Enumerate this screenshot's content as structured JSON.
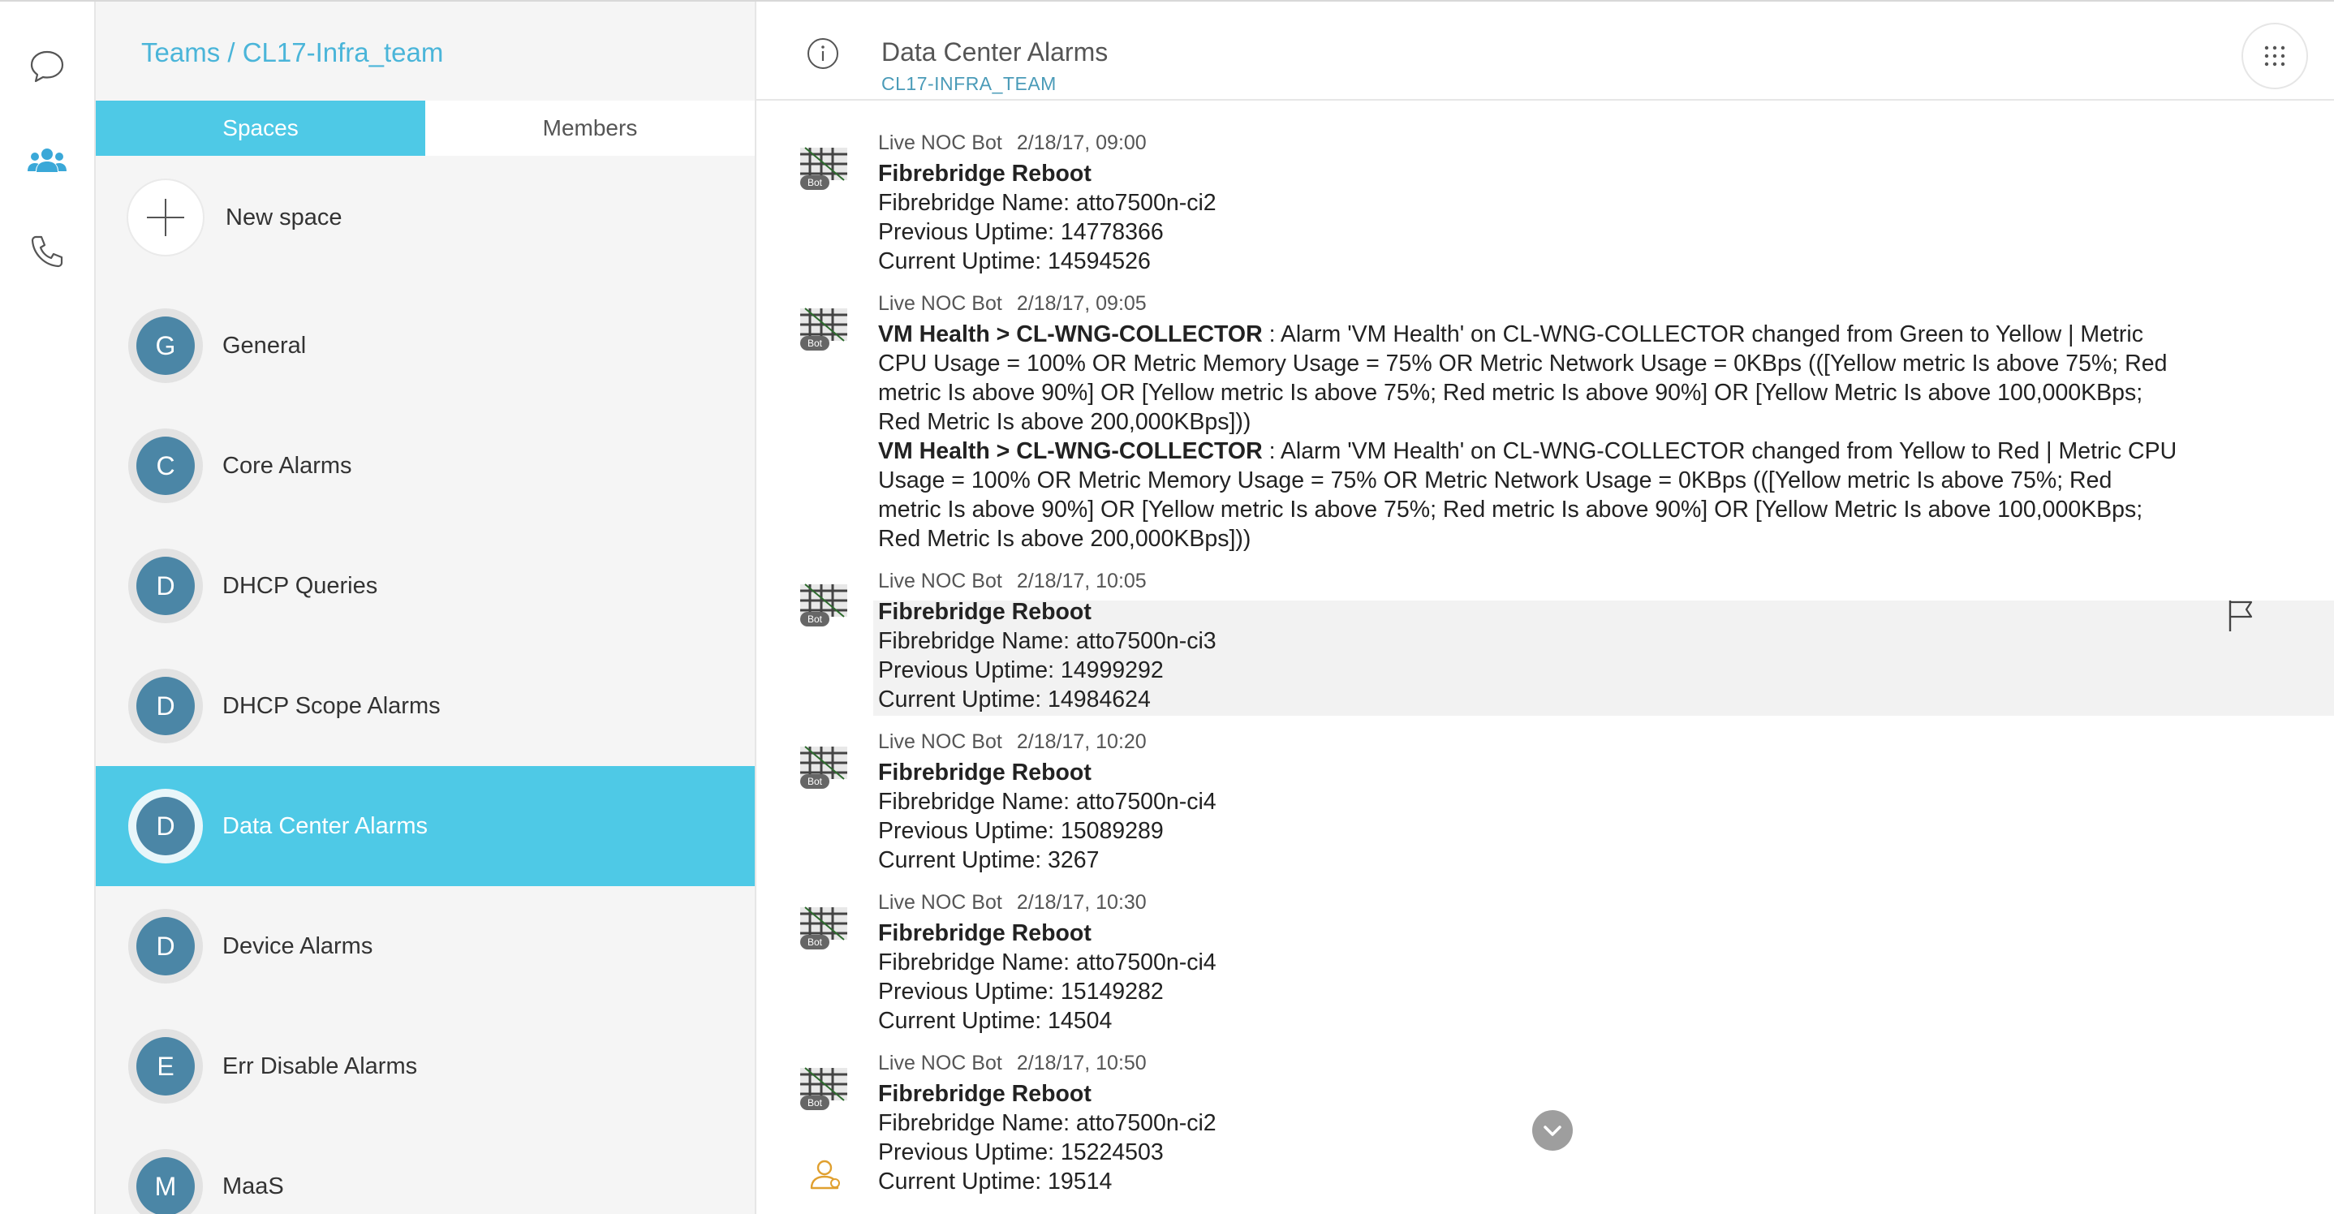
{
  "rail": {
    "items": [
      {
        "name": "chat-icon"
      },
      {
        "name": "teams-icon"
      },
      {
        "name": "phone-icon"
      }
    ]
  },
  "sidebar": {
    "breadcrumb": {
      "teams": "Teams",
      "separator": " / ",
      "team": "CL17-Infra_team"
    },
    "tabs": {
      "spaces": "Spaces",
      "members": "Members"
    },
    "new_space": "New space",
    "spaces": [
      {
        "initial": "G",
        "name": "General"
      },
      {
        "initial": "C",
        "name": "Core Alarms"
      },
      {
        "initial": "D",
        "name": "DHCP Queries"
      },
      {
        "initial": "D",
        "name": "DHCP Scope Alarms"
      },
      {
        "initial": "D",
        "name": "Data Center Alarms",
        "selected": true
      },
      {
        "initial": "D",
        "name": "Device Alarms"
      },
      {
        "initial": "E",
        "name": "Err Disable Alarms"
      },
      {
        "initial": "M",
        "name": "MaaS"
      }
    ]
  },
  "header": {
    "title": "Data Center Alarms",
    "subtitle": "CL17-INFRA_TEAM"
  },
  "messages": [
    {
      "sender": "Live NOC Bot",
      "time": "2/18/17, 09:00",
      "title": "Fibrebridge Reboot",
      "lines": [
        "Fibrebridge Name: atto7500n-ci2",
        "Previous Uptime: 14778366",
        "Current Uptime: 14594526"
      ]
    },
    {
      "sender": "Live NOC Bot",
      "time": "2/18/17, 09:05",
      "alerts": [
        {
          "title": "VM Health > CL-WNG-COLLECTOR",
          "lines": [
            " : Alarm 'VM Health' on CL-WNG-COLLECTOR changed from Green to Yellow | Metric",
            "CPU Usage = 100% OR Metric Memory Usage = 75% OR Metric Network Usage = 0KBps (([Yellow metric Is above 75%; Red",
            "metric Is above 90%] OR [Yellow metric Is above 75%; Red metric Is above 90%] OR [Yellow Metric Is above 100,000KBps;",
            "Red Metric Is above 200,000KBps]))"
          ]
        },
        {
          "title": "VM Health > CL-WNG-COLLECTOR",
          "lines": [
            " : Alarm 'VM Health' on CL-WNG-COLLECTOR changed from Yellow to Red | Metric CPU",
            "Usage = 100% OR Metric Memory Usage = 75% OR Metric Network Usage = 0KBps (([Yellow metric Is above 75%; Red",
            "metric Is above 90%] OR [Yellow metric Is above 75%; Red metric Is above 90%] OR [Yellow Metric Is above 100,000KBps;",
            "Red Metric Is above 200,000KBps]))"
          ]
        }
      ]
    },
    {
      "sender": "Live NOC Bot",
      "time": "2/18/17, 10:05",
      "title": "Fibrebridge Reboot",
      "lines": [
        "Fibrebridge Name: atto7500n-ci3",
        "Previous Uptime: 14999292",
        "Current Uptime: 14984624"
      ]
    },
    {
      "sender": "Live NOC Bot",
      "time": "2/18/17, 10:20",
      "title": "Fibrebridge Reboot",
      "lines": [
        "Fibrebridge Name: atto7500n-ci4",
        "Previous Uptime: 15089289",
        "Current Uptime: 3267"
      ]
    },
    {
      "sender": "Live NOC Bot",
      "time": "2/18/17, 10:30",
      "title": "Fibrebridge Reboot",
      "lines": [
        "Fibrebridge Name: atto7500n-ci4",
        "Previous Uptime: 15149282",
        "Current Uptime: 14504"
      ]
    },
    {
      "sender": "Live NOC Bot",
      "time": "2/18/17, 10:50",
      "title": "Fibrebridge Reboot",
      "lines": [
        "Fibrebridge Name: atto7500n-ci2",
        "Previous Uptime: 15224503",
        "Current Uptime: 19514"
      ]
    }
  ],
  "bot_badge": "Bot",
  "colors": {
    "accent": "#4ec9e6",
    "avatar": "#4b86a6",
    "link": "#4ab5d9"
  }
}
